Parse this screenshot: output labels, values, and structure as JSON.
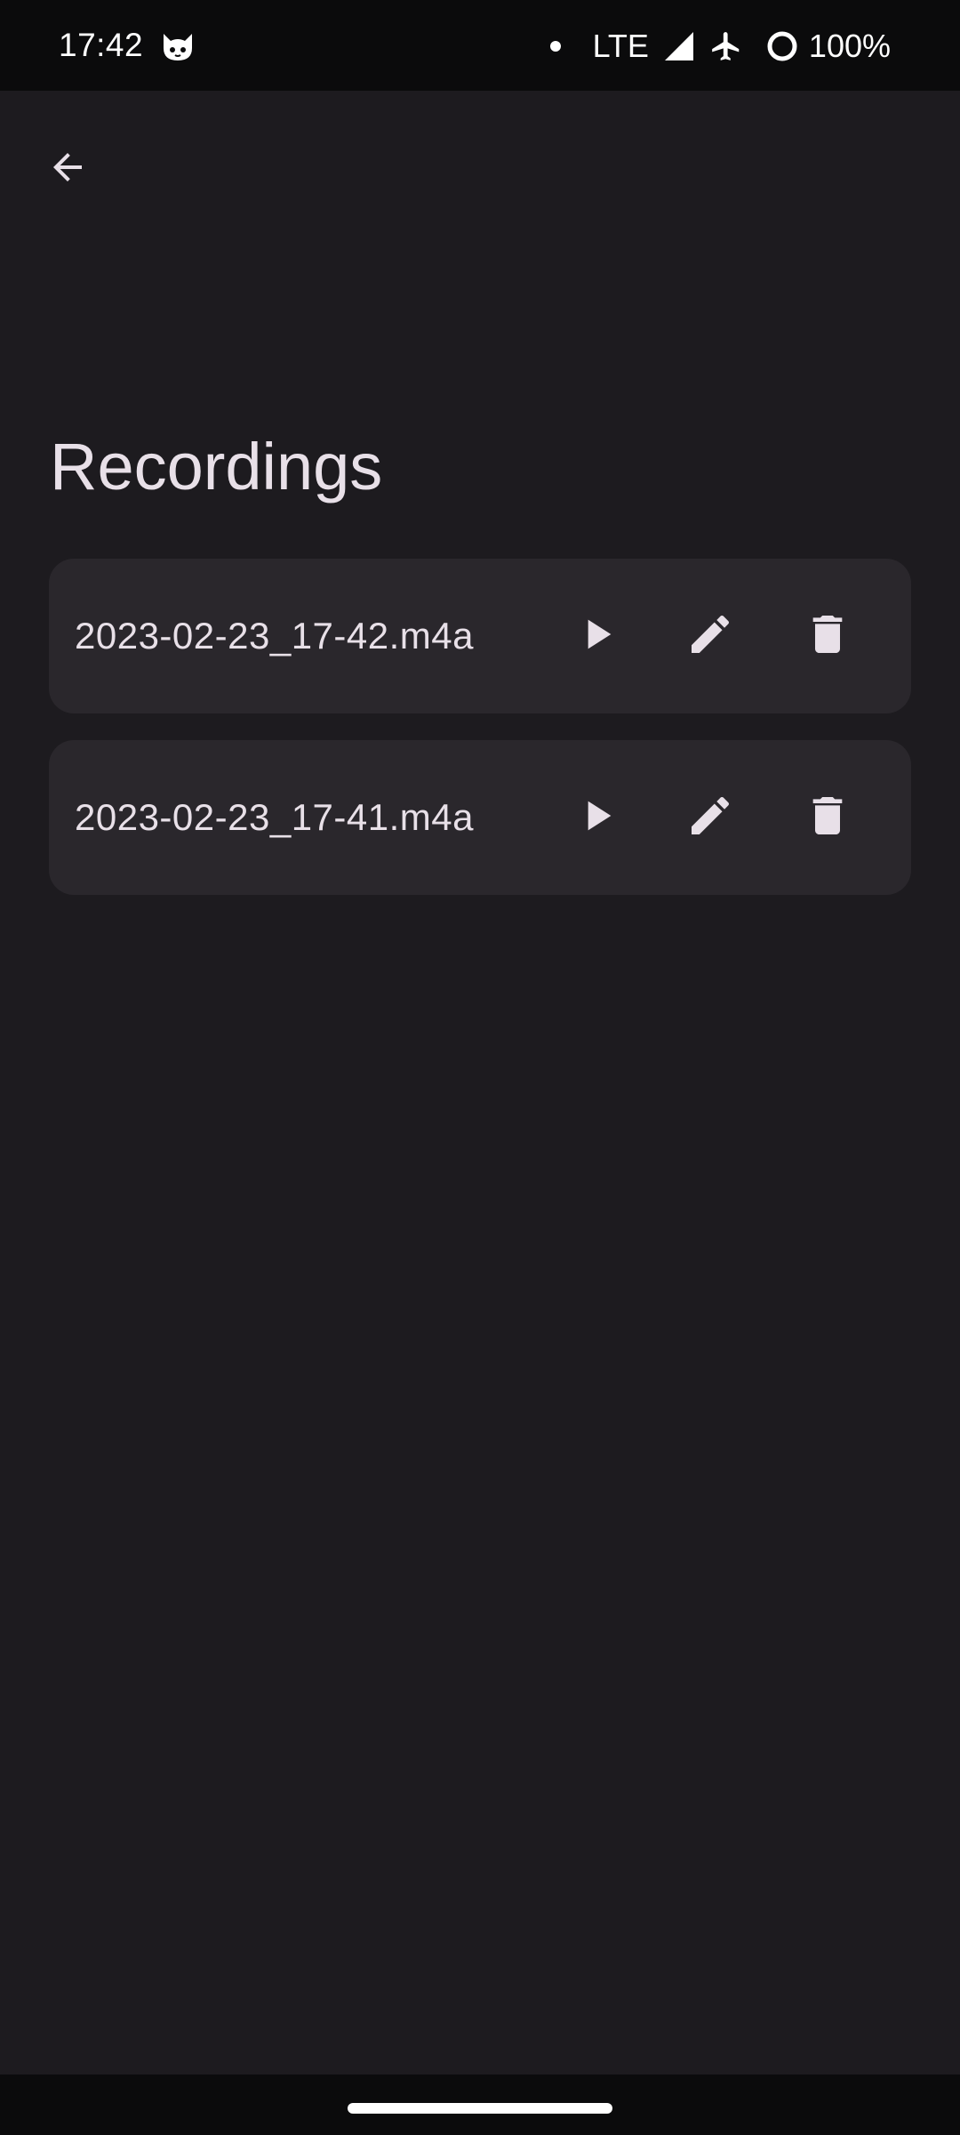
{
  "status_bar": {
    "time": "17:42",
    "network": "LTE",
    "battery": "100%",
    "icons": [
      "cat-face-icon",
      "notification-dot-icon",
      "signal-icon",
      "airplane-mode-icon",
      "battery-saver-icon"
    ]
  },
  "header": {
    "back_icon": "arrow-back-icon",
    "title": "Recordings"
  },
  "recordings": [
    {
      "filename": "2023-02-23_17-42.m4a"
    },
    {
      "filename": "2023-02-23_17-41.m4a"
    }
  ],
  "row_actions": [
    "play-icon",
    "edit-icon",
    "delete-icon"
  ],
  "colors": {
    "background": "#1d1b1f",
    "card": "#2a272c",
    "text": "#e8e0e8",
    "system_bar": "#0b0b0c"
  }
}
